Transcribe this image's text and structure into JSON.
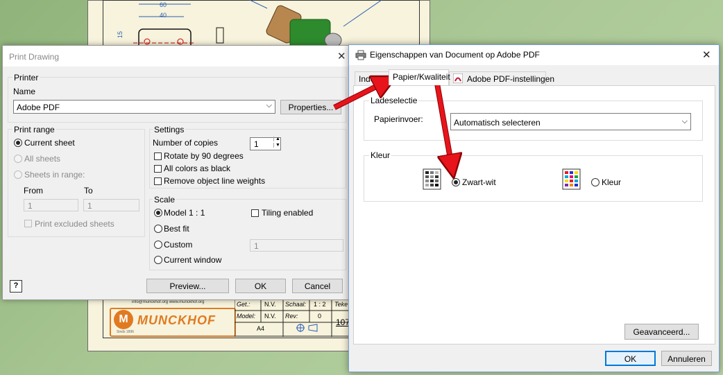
{
  "drawing": {
    "dims": [
      "60",
      "40",
      "15"
    ],
    "titleblock": {
      "contact": "info@munckhof.org   www.munckhof.org",
      "logo": "MUNCKHOF",
      "logo_since": "Sinds 1896",
      "get_label": "Get.:",
      "get_value": "N.V.",
      "schaal_label": "Schaal:",
      "schaal_value": "1 : 2",
      "teke_label": "Teke",
      "model_label": "Model:",
      "model_value": "N.V.",
      "rev_label": "Rev:",
      "rev_value": "0",
      "size": "A4",
      "number": "107"
    }
  },
  "print_dialog": {
    "title": "Print Drawing",
    "printer_group": "Printer",
    "name_label": "Name",
    "printer_name": "Adobe PDF",
    "properties_button": "Properties...",
    "print_range_group": "Print range",
    "current_sheet": "Current sheet",
    "all_sheets": "All sheets",
    "sheets_in_range": "Sheets in range:",
    "from_label": "From",
    "to_label": "To",
    "from_value": "1",
    "to_value": "1",
    "print_excluded": "Print excluded sheets",
    "settings_group": "Settings",
    "copies_label": "Number of copies",
    "copies_value": "1",
    "rotate": "Rotate by 90 degrees",
    "all_black": "All colors as black",
    "remove_weights": "Remove object line weights",
    "scale_group": "Scale",
    "model_1_1": "Model 1 : 1",
    "tiling": "Tiling enabled",
    "best_fit": "Best fit",
    "custom": "Custom",
    "custom_value": "1",
    "current_window": "Current window",
    "help_icon": "?",
    "preview_button": "Preview...",
    "ok_button": "OK",
    "cancel_button": "Cancel"
  },
  "adobe_dialog": {
    "title": "Eigenschappen van Document op Adobe PDF",
    "tabs": [
      "Indeling",
      "Papier/Kwaliteit",
      "Adobe PDF-instellingen"
    ],
    "tray_group": "Ladeselectie",
    "paper_source_label": "Papierinvoer:",
    "paper_source_value": "Automatisch selecteren",
    "color_group": "Kleur",
    "bw_option": "Zwart-wit",
    "color_option": "Kleur",
    "advanced_button": "Geavanceerd...",
    "ok_button": "OK",
    "cancel_button": "Annuleren"
  },
  "icons": [
    "printer-icon",
    "close-icon",
    "chevron-down-icon",
    "help-icon",
    "pdf-icon",
    "bw-page-icon",
    "color-page-icon"
  ],
  "colors": {
    "annotation_arrow": "#e8141c",
    "ok_focus": "#0078d7",
    "dim_blue": "#2b5fb3"
  }
}
